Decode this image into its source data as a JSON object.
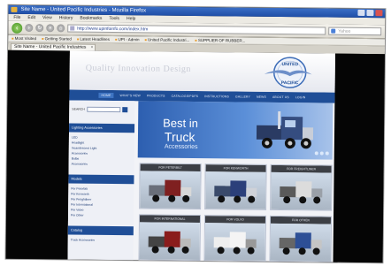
{
  "browser": {
    "window_title": "Site Name - United Pacific Industries - Mozilla Firefox",
    "menu": [
      "File",
      "Edit",
      "View",
      "History",
      "Bookmarks",
      "Tools",
      "Help"
    ],
    "url": "http://www.upinfoinfo.com/index.htm",
    "search_placeholder": "Yahoo",
    "bookmarks": [
      "Most Visited",
      "Getting Started",
      "Latest Headlines",
      "UPI - Admin",
      "United Pacific Industri...",
      "SUPPLIER OF RUBBER..."
    ],
    "tab_label": "Site Name - United Pacific Industries"
  },
  "site": {
    "tagline": "Quality   Innovation   Design",
    "logo_text_top": "UNITED",
    "logo_text_bottom": "PACIFIC",
    "nav": [
      "HOME",
      "WHAT'S NEW",
      "PRODUCTS",
      "CATALOGS/PDFS",
      "INSTRUCTIONS",
      "GALLERY",
      "NEWS",
      "ABOUT US",
      "LOGIN"
    ],
    "search_label": "SEARCH",
    "sidebar": {
      "lighting_heading": "Lighting Accessories",
      "lighting_items": [
        "LED",
        "Headlight",
        "Incandescent Light",
        "Accessories",
        "Bulbs",
        "Accessories"
      ],
      "models_heading": "Models",
      "models_items": [
        "For Peterbilt",
        "For Kenworth",
        "For Freightliner",
        "For International",
        "For Volvo",
        "For Other"
      ],
      "catalog_heading": "Catalog",
      "catalog_items": [
        "Truck Accessories"
      ]
    },
    "banner": {
      "line1": "Best in",
      "line2": "Truck",
      "line3": "Accessories"
    },
    "cards": [
      "FOR PETERBILT",
      "FOR KENWORTH",
      "FOR FREIGHTLINER",
      "FOR INTERNATIONAL",
      "FOR VOLVO",
      "FOR OTHER"
    ]
  },
  "colors": {
    "nav_blue": "#1f4e97",
    "banner_blue": "#2d5fb0",
    "page_black": "#050505"
  }
}
